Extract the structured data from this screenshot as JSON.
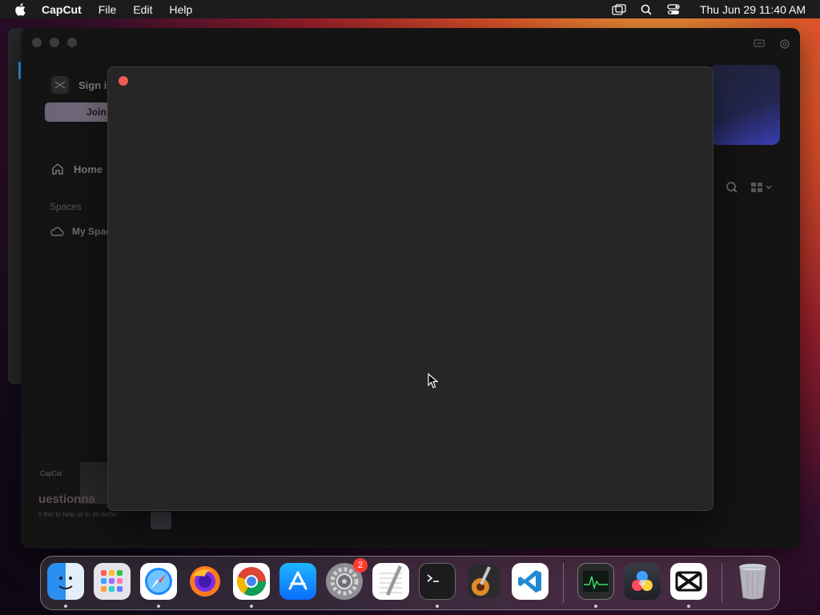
{
  "menubar": {
    "apple_icon": "apple-logo",
    "app_name": "CapCut",
    "menus": [
      "File",
      "Edit",
      "Help"
    ],
    "status_icons": [
      "display-icon",
      "search-icon",
      "control-center-icon"
    ],
    "clock": "Thu Jun 29  11:40 AM"
  },
  "capcut": {
    "sidebar": {
      "sign_in": "Sign in",
      "join": "Join",
      "home": "Home",
      "spaces_heading": "Spaces",
      "my_space": "My Space"
    },
    "promo": {
      "brand": "CapCut",
      "title": "uestionna",
      "subtitle": "n this to help us to do better"
    }
  },
  "dialog": {
    "close_color": "#ee5b55",
    "background": "#262626"
  },
  "dock": {
    "apps": [
      {
        "name": "Finder",
        "icon": "finder-icon",
        "running": true
      },
      {
        "name": "Launchpad",
        "icon": "launchpad-icon",
        "running": false
      },
      {
        "name": "Safari",
        "icon": "safari-icon",
        "running": true
      },
      {
        "name": "Firefox",
        "icon": "firefox-icon",
        "running": false
      },
      {
        "name": "Chrome",
        "icon": "chrome-icon",
        "running": true
      },
      {
        "name": "App Store",
        "icon": "app-store-icon",
        "running": false
      },
      {
        "name": "System Settings",
        "icon": "system-settings-icon",
        "running": false,
        "badge": "2"
      },
      {
        "name": "TextEdit",
        "icon": "textedit-icon",
        "running": false
      },
      {
        "name": "Terminal",
        "icon": "terminal-icon",
        "running": true
      },
      {
        "name": "GarageBand",
        "icon": "garageband-icon",
        "running": false
      },
      {
        "name": "VS Code",
        "icon": "vscode-icon",
        "running": false
      },
      {
        "name": "Activity Monitor",
        "icon": "activity-monitor-icon",
        "running": true
      },
      {
        "name": "DaVinci Resolve",
        "icon": "davinci-resolve-icon",
        "running": false
      },
      {
        "name": "CapCut",
        "icon": "capcut-icon",
        "running": true
      },
      {
        "name": "Trash",
        "icon": "trash-icon",
        "running": false
      }
    ]
  }
}
